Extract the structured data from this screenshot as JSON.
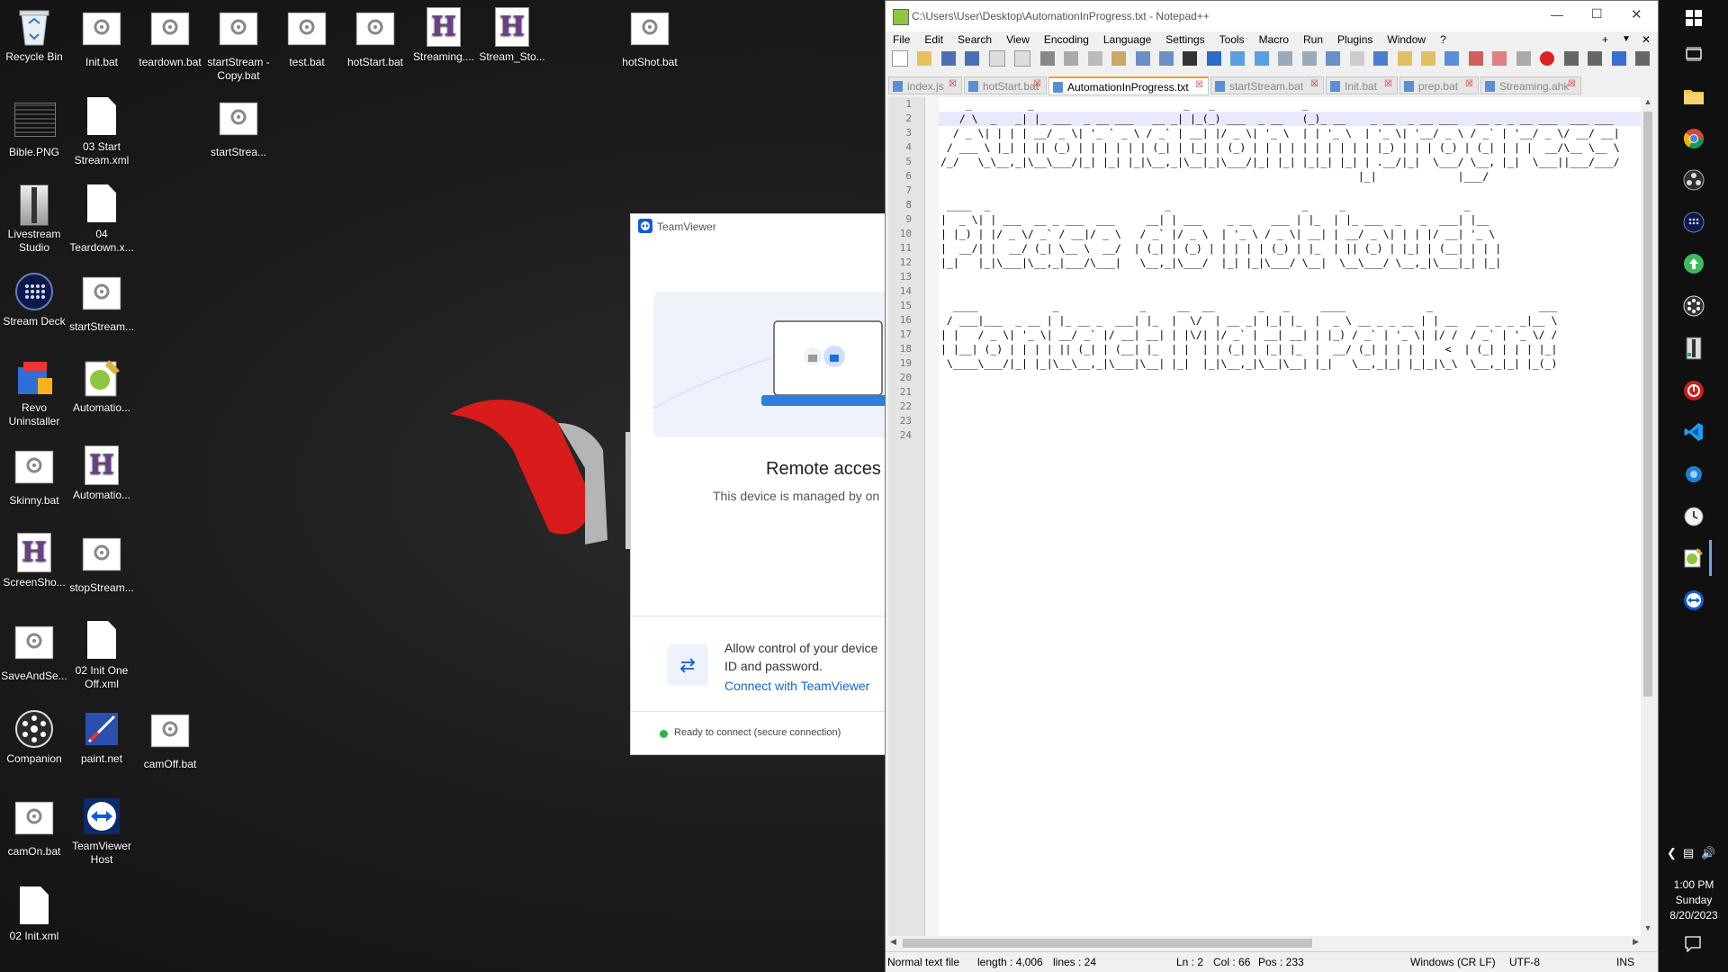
{
  "desktop": {
    "icons": [
      {
        "label": "Recycle Bin",
        "kind": "recycle"
      },
      {
        "label": "Init.bat",
        "kind": "bat"
      },
      {
        "label": "teardown.bat",
        "kind": "bat"
      },
      {
        "label": "startStream - Copy.bat",
        "kind": "bat"
      },
      {
        "label": "test.bat",
        "kind": "bat"
      },
      {
        "label": "hotStart.bat",
        "kind": "bat"
      },
      {
        "label": "Streaming....",
        "kind": "ahk"
      },
      {
        "label": "Stream_Sto...",
        "kind": "ahk"
      },
      {
        "label": "hotShot.bat",
        "kind": "bat"
      },
      {
        "label": "Bible.PNG",
        "kind": "png"
      },
      {
        "label": "03 Start Stream.xml",
        "kind": "doc"
      },
      {
        "label": "startStrea...",
        "kind": "bat"
      },
      {
        "label": "Livestream Studio",
        "kind": "livestream"
      },
      {
        "label": "04 Teardown.x...",
        "kind": "doc"
      },
      {
        "label": "Stream Deck",
        "kind": "streamdeck"
      },
      {
        "label": "startStream...",
        "kind": "bat"
      },
      {
        "label": "Revo Uninstaller",
        "kind": "revo"
      },
      {
        "label": "Automatio...",
        "kind": "notepadpp"
      },
      {
        "label": "Skinny.bat",
        "kind": "bat"
      },
      {
        "label": "Automatio...",
        "kind": "ahk"
      },
      {
        "label": "ScreenSho...",
        "kind": "ahk"
      },
      {
        "label": "stopStream...",
        "kind": "bat"
      },
      {
        "label": "SaveAndSe...",
        "kind": "bat"
      },
      {
        "label": "02 Init One Off.xml",
        "kind": "doc"
      },
      {
        "label": "Companion",
        "kind": "companion"
      },
      {
        "label": "paint.net",
        "kind": "paintnet"
      },
      {
        "label": "camOff.bat",
        "kind": "bat"
      },
      {
        "label": "camOn.bat",
        "kind": "bat"
      },
      {
        "label": "TeamViewer Host",
        "kind": "teamviewer"
      },
      {
        "label": "02 Init.xml",
        "kind": "doc"
      }
    ]
  },
  "teamviewer": {
    "title": "TeamViewer",
    "heading": "Remote acces",
    "subtext": "This device is managed by on",
    "allow_text_1": "Allow control of your device",
    "allow_text_2": "ID and password.",
    "connect_link": "Connect with TeamViewer",
    "status": "Ready to connect (secure connection)",
    "status_color": "#2db34a"
  },
  "notepad": {
    "title": "C:\\Users\\User\\Desktop\\AutomationInProgress.txt - Notepad++",
    "menu": [
      "File",
      "Edit",
      "Search",
      "View",
      "Encoding",
      "Language",
      "Settings",
      "Tools",
      "Macro",
      "Run",
      "Plugins",
      "Window",
      "?"
    ],
    "menu_right": [
      "+",
      "▼",
      "✕"
    ],
    "tabs": [
      {
        "label": "index.js",
        "active": false
      },
      {
        "label": "hotStart.bat",
        "active": false
      },
      {
        "label": "AutomationInProgress.txt",
        "active": true
      },
      {
        "label": "startStream.bat",
        "active": false
      },
      {
        "label": "Init.bat",
        "active": false
      },
      {
        "label": "prep.bat",
        "active": false
      },
      {
        "label": "Streaming.ahk",
        "active": false
      }
    ],
    "line_numbers": [
      "1",
      "2",
      "3",
      "4",
      "5",
      "6",
      "7",
      "8",
      "9",
      "10",
      "11",
      "12",
      "13",
      "14",
      "15",
      "16",
      "17",
      "18",
      "19",
      "20",
      "21",
      "22",
      "23",
      "24"
    ],
    "text": "    _         _                        _   _              _\n   / \\  _   _| |_ ___  _ __ ___   __ _| |_(_) ___  _ __   (_)_ __    _ __  _ __ ___   __ _ _ __ ___  ___ ___\n  / _ \\| | | | __/ _ \\| '_ ` _ \\ / _` | __| |/ _ \\| '_ \\  | | '_ \\  | '_ \\| '__/ _ \\ / _` | '__/ _ \\/ __/ __|\n / ___ \\ |_| | || (_) | | | | | | (_| | |_| | (_) | | | | | | | | | | |_) | | | (_) | (_| | | |  __/\\__ \\__ \\\n/_/   \\_\\__,_|\\__\\___/|_| |_| |_|\\__,_|\\__|_|\\___/|_| |_| |_|_| |_| | .__/|_|  \\___/ \\__, |_|  \\___||___/___/\n                                                                   |_|             |___/\n\n ____  _                            _                     _     _                   _\n|  _ \\| | ___  __ _ ___  ___     __| | ___    _ __   ___ | |_  | |_ ___  _   _  ___| |__\n| |_) | |/ _ \\/ _` / __|/ _ \\   / _` |/ _ \\  | '_ \\ / _ \\| __| | __/ _ \\| | | |/ __| '_ \\\n|  __/| |  __/ (_| \\__ \\  __/  | (_| | (_) | | | | | (_) | |_  | || (_) | |_| | (__| | | |\n|_|   |_|\\___|\\__,_|___/\\___|   \\__,_|\\___/  |_| |_|\\___/ \\__|  \\__\\___/ \\__,_|\\___|_| |_|\n\n\n  ____            _             _     __  __       _   _     ____             _                 ___\n / ___|___  _ __ | |_ __ _  ___| |_  |  \\/  | __ _| |_| |_  |  _ \\ __ _ _ __ | | __   __ _ _ _|__ \\\n| |   / _ \\| '_ \\| __/ _` |/ __| __| | |\\/| |/ _` | __| __| | |_) / _` | '_ \\| |/ /  / _` | '_ \\/ /\n| |__| (_) | | | | || (_| | (__| |_  | |  | | (_| | |_| |_  |  __/ (_| | | | |   <  | (_| | | | |_|\n \\____\\___/|_| |_|\\__\\__,_|\\___|\\__| |_|  |_|\\__,_|\\__|\\__| |_|   \\__,_|_| |_|_|\\_\\  \\__,_|_| |_(_)\n\n",
    "status": {
      "file_type": "Normal text file",
      "length": "length : 4,006",
      "lines": "lines : 24",
      "ln": "Ln : 2",
      "col": "Col : 66",
      "pos": "Pos : 233",
      "eol": "Windows (CR LF)",
      "encoding": "UTF-8",
      "mode": "INS"
    }
  },
  "taskbar": {
    "time": "1:00 PM",
    "day": "Sunday",
    "date": "8/20/2023"
  },
  "colors": {
    "accent_blue": "#0e5bd8",
    "tab_active_orange": "#f29b2a",
    "teamviewer_blue": "#0e67d6"
  }
}
